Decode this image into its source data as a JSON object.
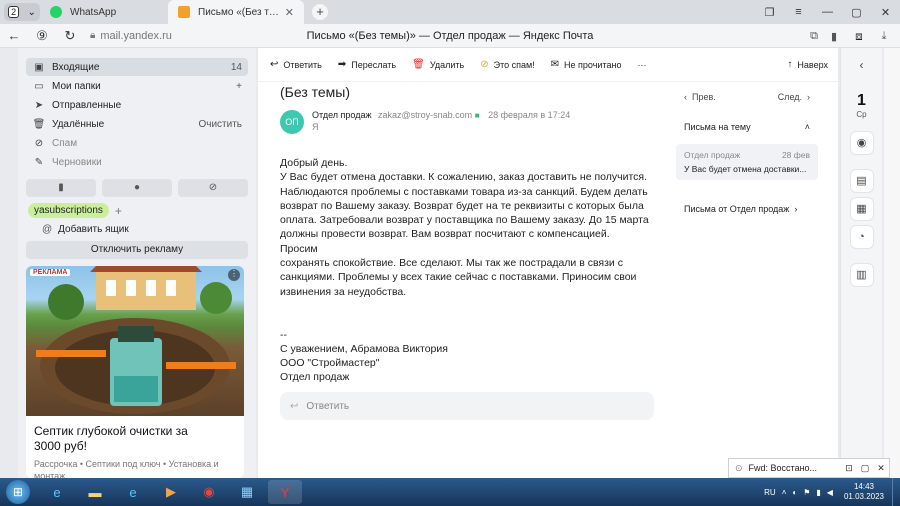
{
  "tabs": {
    "counter": "2",
    "whatsapp_title": "WhatsApp",
    "active_title": "Письмо «(Без темы)» —",
    "new_tab": "+"
  },
  "address": {
    "url": "mail.yandex.ru",
    "page_title": "Письмо «(Без темы)» — Отдел продаж — Яндекс Почта"
  },
  "sidebar": {
    "folders": [
      {
        "label": "Входящие",
        "count": "14",
        "icon": "inbox-icon"
      },
      {
        "label": "Мои папки",
        "extra": "+",
        "icon": "folder-icon"
      },
      {
        "label": "Отправленные",
        "icon": "sent-icon"
      },
      {
        "label": "Удалённые",
        "extra": "Очистить",
        "icon": "trash-icon"
      },
      {
        "label": "Спам",
        "icon": "spam-icon"
      },
      {
        "label": "Черновики",
        "icon": "draft-icon"
      }
    ],
    "label_chip": "yasubscriptions",
    "add_mailbox": "Добавить ящик",
    "ad_off": "Отключить рекламу",
    "ad": {
      "badge": "РЕКЛАМА",
      "title": "Септик глубокой очистки за 3000 руб!",
      "subtitle": "Рассрочка • Септики под ключ • Установка и монтаж"
    }
  },
  "toolbar": {
    "reply": "Ответить",
    "forward": "Переслать",
    "delete": "Удалить",
    "spam": "Это спам!",
    "unread": "Не прочитано",
    "more": "···",
    "back": "Наверх"
  },
  "letter": {
    "subject": "(Без темы)",
    "avatar": "ОП",
    "sender_name": "Отдел продаж",
    "sender_email": "zakaz@stroy-snab.com",
    "date": "28 февраля в 17:24",
    "to": "Я",
    "body": "Добрый день.\nУ Вас будет отмена доставки. К сожалению, заказ доставить не получится.\nНаблюдаются проблемы с поставками товара из-за санкций. Будем делать возврат по Вашему заказу. Возврат будет на те реквизиты с которых была оплата. Затребовали возврат у поставщика по Вашему заказу. До 15 марта должны провести возврат. Вам возврат посчитают с компенсацией.\nПросим\nсохранять спокойствие. Все сделают. Мы так же пострадали в связи с санкциями. Проблемы у всех такие сейчас с поставками. Приносим свои извинения за неудобства.\n\n\n--\nС уважением, Абрамова Виктория\nООО \"Строймастер\"\nОтдел продаж",
    "reply_placeholder": "Ответить"
  },
  "side_panel": {
    "prev": "Прев.",
    "next": "След.",
    "thread_title": "Письма на тему",
    "thread_item": {
      "from": "Отдел продаж",
      "date": "28 фев",
      "preview": "У Вас будет отмена доставки..."
    },
    "from_sender": "Письма от Отдел продаж"
  },
  "rail": {
    "day": "1",
    "dow": "Ср"
  },
  "notification": {
    "text": "Fwd: Восстано..."
  },
  "taskbar": {
    "lang": "RU",
    "time": "14:43",
    "date": "01.03.2023"
  }
}
